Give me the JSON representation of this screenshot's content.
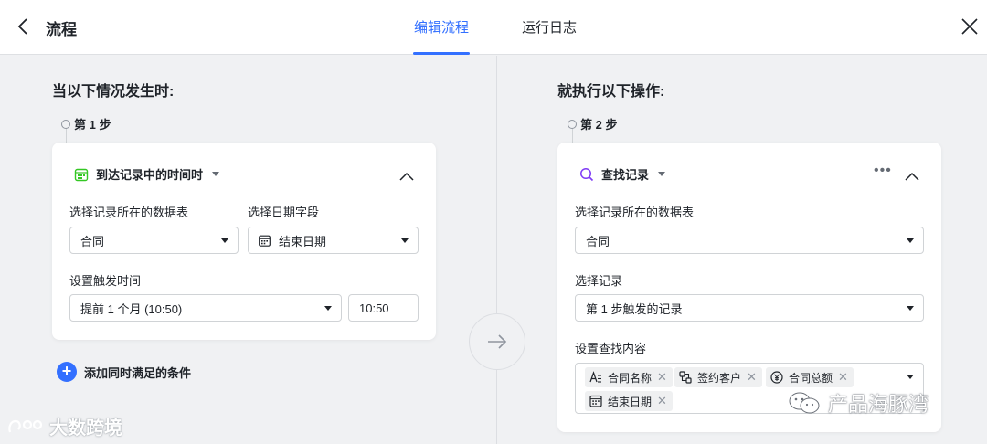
{
  "header": {
    "title": "流程",
    "tabs": [
      {
        "label": "编辑流程",
        "active": true
      },
      {
        "label": "运行日志",
        "active": false
      }
    ]
  },
  "left": {
    "section_title": "当以下情况发生时:",
    "step_label": "第 1 步",
    "trigger_label": "到达记录中的时间时",
    "table_label": "选择记录所在的数据表",
    "table_value": "合同",
    "date_field_label": "选择日期字段",
    "date_field_value": "结束日期",
    "trigger_time_label": "设置触发时间",
    "trigger_time_value": "提前 1 个月 (10:50)",
    "time_value": "10:50",
    "add_condition_label": "添加同时满足的条件"
  },
  "right": {
    "section_title": "就执行以下操作:",
    "step_label": "第 2 步",
    "action_label": "查找记录",
    "table_label": "选择记录所在的数据表",
    "table_value": "合同",
    "record_label": "选择记录",
    "record_value": "第 1 步触发的记录",
    "content_label": "设置查找内容",
    "tags": [
      {
        "label": "合同名称",
        "icon": "text-field-icon"
      },
      {
        "label": "签约客户",
        "icon": "link-field-icon"
      },
      {
        "label": "合同总额",
        "icon": "currency-field-icon"
      },
      {
        "label": "结束日期",
        "icon": "date-field-icon"
      }
    ]
  },
  "watermarks": {
    "left": "大数跨境",
    "right": "产品海豚湾"
  },
  "colors": {
    "accent": "#3370ff",
    "green_icon": "#34c724",
    "purple_icon": "#7f3bf5"
  }
}
